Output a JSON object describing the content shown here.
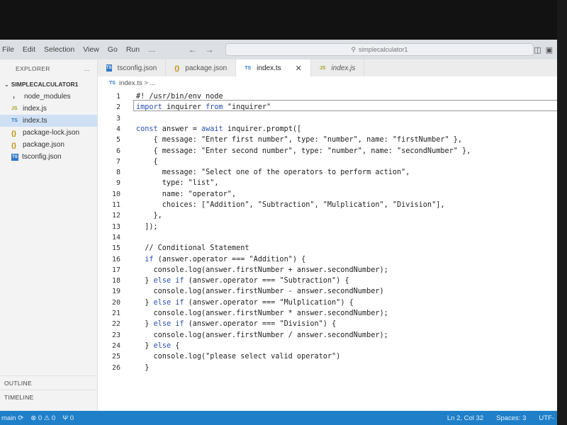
{
  "app": {
    "menu": [
      "File",
      "Edit",
      "Selection",
      "View",
      "Go",
      "Run",
      "…"
    ],
    "search_text": "simplecalculator1"
  },
  "sidebar": {
    "title": "EXPLORER",
    "more": "…",
    "root": "SIMPLECALCULATOR1",
    "items": [
      {
        "label": "node_modules",
        "icon": "chevron-right-icon"
      },
      {
        "label": "index.js",
        "icon": "JS"
      },
      {
        "label": "index.ts",
        "icon": "TS"
      },
      {
        "label": "package-lock.json",
        "icon": "{}"
      },
      {
        "label": "package.json",
        "icon": "{}"
      },
      {
        "label": "tsconfig.json",
        "icon": "TS"
      }
    ],
    "outline": "OUTLINE",
    "timeline": "TIMELINE"
  },
  "tabs": [
    {
      "label": "tsconfig.json",
      "icon": "TS"
    },
    {
      "label": "package.json",
      "icon": "{}"
    },
    {
      "label": "index.ts",
      "icon": "TS",
      "close": "✕"
    },
    {
      "label": "index.js",
      "icon": "JS"
    }
  ],
  "breadcrumb": {
    "icon": "TS",
    "text": "index.ts > ..."
  },
  "code": {
    "line_numbers": [
      "1",
      "2",
      "3",
      "4",
      "5",
      "6",
      "7",
      "8",
      "9",
      "10",
      "11",
      "12",
      "13",
      "14",
      "15",
      "16",
      "17",
      "18",
      "19",
      "20",
      "21",
      "22",
      "23",
      "24",
      "25",
      "26"
    ],
    "lines": [
      "#! /usr/bin/env node",
      "import inquirer from \"inquirer\"",
      "",
      "const answer = await inquirer.prompt([",
      "    { message: \"Enter first number\", type: \"number\", name: \"firstNumber\" },",
      "    { message: \"Enter second number\", type: \"number\", name: \"secondNumber\" },",
      "    {",
      "      message: \"Select one of the operators to perform action\",",
      "      type: \"list\",",
      "      name: \"operator\",",
      "      choices: [\"Addition\", \"Subtraction\", \"Mulplication\", \"Division\"],",
      "    },",
      "  ]);",
      "",
      "  // Conditional Statement",
      "  if (answer.operator === \"Addition\") {",
      "    console.log(answer.firstNumber + answer.secondNumber);",
      "  } else if (answer.operator === \"Subtraction\") {",
      "    console.log(answer.firstNumber - answer.secondNumber)",
      "  } else if (answer.operator === \"Mulplication\") {",
      "    console.log(answer.firstNumber * answer.secondNumber);",
      "  } else if (answer.operator === \"Division\") {",
      "    console.log(answer.firstNumber / answer.secondNumber);",
      "  } else {",
      "    console.log(\"please select valid operator\")",
      "  }"
    ]
  },
  "status": {
    "branch": "main",
    "errors": "0",
    "warnings": "0",
    "ports": "0",
    "cursor": "Ln 2, Col 32",
    "spaces": "Spaces: 3",
    "encoding": "UTF-"
  },
  "colors": {
    "accent": "#1f80c9",
    "keyword": "#2a4fb0",
    "selection": "#cfe0f5"
  }
}
